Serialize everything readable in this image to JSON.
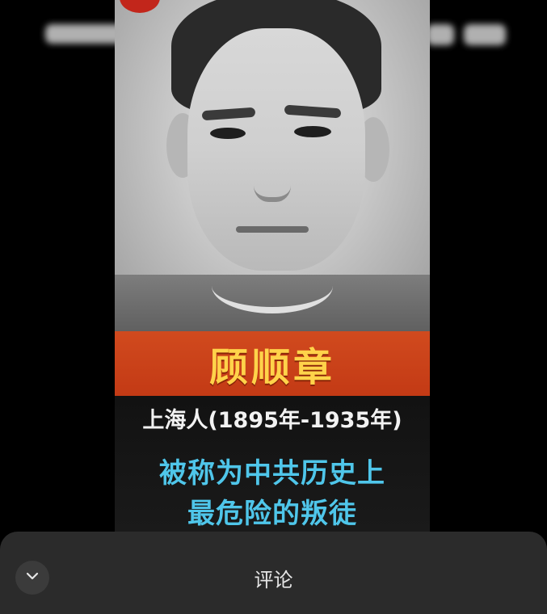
{
  "video": {
    "name": "顾顺章",
    "subtitle": "上海人(1895年-1935年)",
    "description_line1": "被称为中共历史上",
    "description_line2": "最危险的叛徒"
  },
  "comment_sheet": {
    "title": "评论",
    "collapse_icon": "chevron-down-icon"
  },
  "colors": {
    "banner": "#c33a15",
    "name_text": "#ffd34a",
    "description_text": "#4fc6ea",
    "sheet_background": "#2b2b2b"
  }
}
